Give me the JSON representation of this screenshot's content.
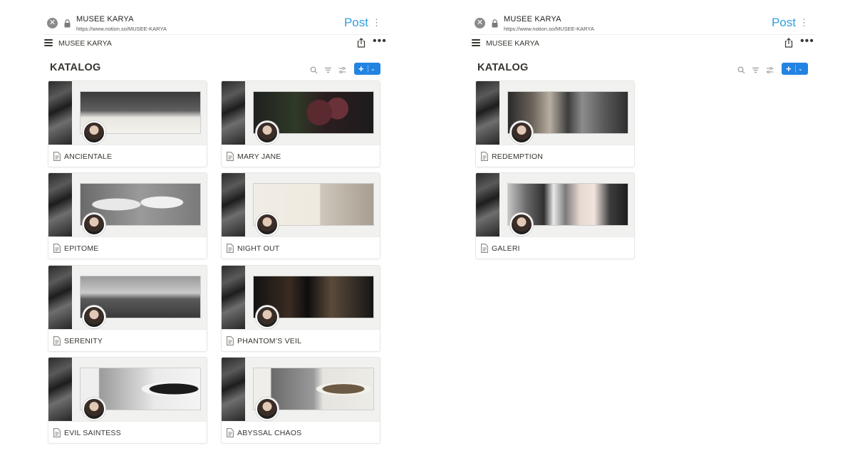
{
  "browser": {
    "site_title": "MUSEE KARYA",
    "site_url": "https://www.notion.so/MUSEE-KARYA",
    "post_label": "Post"
  },
  "page": {
    "title": "MUSEE KARYA"
  },
  "database": {
    "title": "KATALOG"
  },
  "icons": {
    "close": "close-icon",
    "lock": "lock-icon",
    "more": "kebab-icon",
    "menu": "hamburger-icon",
    "share": "share-icon",
    "dots": "more-dots-icon",
    "search": "search-icon",
    "filter": "filter-icon",
    "settings": "sliders-icon",
    "new": "plus-icon",
    "page": "page-icon"
  },
  "colors": {
    "accent": "#2383e2",
    "post": "#2e9fe0",
    "text": "#37352f"
  },
  "left_cards": [
    {
      "title": "ANCIENTALE"
    },
    {
      "title": "MARY JANE"
    },
    {
      "title": "EPITOME"
    },
    {
      "title": "NIGHT OUT"
    },
    {
      "title": "SERENITY"
    },
    {
      "title": "PHANTOM’S VEIL"
    },
    {
      "title": "EVIL SAINTESS"
    },
    {
      "title": "ABYSSAL CHAOS"
    }
  ],
  "right_cards": [
    {
      "title": "REDEMPTION"
    },
    {
      "title": "GALERI"
    }
  ]
}
